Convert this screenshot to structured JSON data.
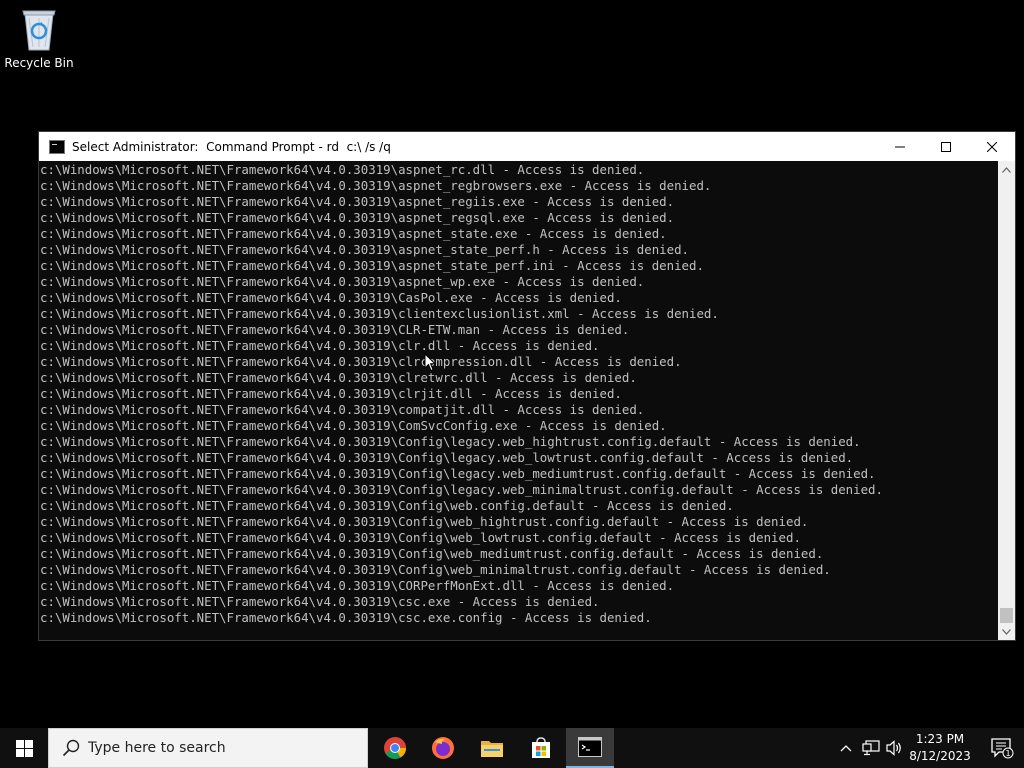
{
  "desktop": {
    "icons": [
      {
        "label": "Recycle Bin",
        "icon": "recycle-bin-icon"
      }
    ]
  },
  "window": {
    "title": "Select Administrator:  Command Prompt - rd  c:\\ /s /q",
    "controls": {
      "minimize": "minimize-icon",
      "maximize": "maximize-icon",
      "close": "close-icon"
    }
  },
  "console": {
    "lines": [
      "c:\\Windows\\Microsoft.NET\\Framework64\\v4.0.30319\\aspnet_rc.dll - Access is denied.",
      "c:\\Windows\\Microsoft.NET\\Framework64\\v4.0.30319\\aspnet_regbrowsers.exe - Access is denied.",
      "c:\\Windows\\Microsoft.NET\\Framework64\\v4.0.30319\\aspnet_regiis.exe - Access is denied.",
      "c:\\Windows\\Microsoft.NET\\Framework64\\v4.0.30319\\aspnet_regsql.exe - Access is denied.",
      "c:\\Windows\\Microsoft.NET\\Framework64\\v4.0.30319\\aspnet_state.exe - Access is denied.",
      "c:\\Windows\\Microsoft.NET\\Framework64\\v4.0.30319\\aspnet_state_perf.h - Access is denied.",
      "c:\\Windows\\Microsoft.NET\\Framework64\\v4.0.30319\\aspnet_state_perf.ini - Access is denied.",
      "c:\\Windows\\Microsoft.NET\\Framework64\\v4.0.30319\\aspnet_wp.exe - Access is denied.",
      "c:\\Windows\\Microsoft.NET\\Framework64\\v4.0.30319\\CasPol.exe - Access is denied.",
      "c:\\Windows\\Microsoft.NET\\Framework64\\v4.0.30319\\clientexclusionlist.xml - Access is denied.",
      "c:\\Windows\\Microsoft.NET\\Framework64\\v4.0.30319\\CLR-ETW.man - Access is denied.",
      "c:\\Windows\\Microsoft.NET\\Framework64\\v4.0.30319\\clr.dll - Access is denied.",
      "c:\\Windows\\Microsoft.NET\\Framework64\\v4.0.30319\\clrcompression.dll - Access is denied.",
      "c:\\Windows\\Microsoft.NET\\Framework64\\v4.0.30319\\clretwrc.dll - Access is denied.",
      "c:\\Windows\\Microsoft.NET\\Framework64\\v4.0.30319\\clrjit.dll - Access is denied.",
      "c:\\Windows\\Microsoft.NET\\Framework64\\v4.0.30319\\compatjit.dll - Access is denied.",
      "c:\\Windows\\Microsoft.NET\\Framework64\\v4.0.30319\\ComSvcConfig.exe - Access is denied.",
      "c:\\Windows\\Microsoft.NET\\Framework64\\v4.0.30319\\Config\\legacy.web_hightrust.config.default - Access is denied.",
      "c:\\Windows\\Microsoft.NET\\Framework64\\v4.0.30319\\Config\\legacy.web_lowtrust.config.default - Access is denied.",
      "c:\\Windows\\Microsoft.NET\\Framework64\\v4.0.30319\\Config\\legacy.web_mediumtrust.config.default - Access is denied.",
      "c:\\Windows\\Microsoft.NET\\Framework64\\v4.0.30319\\Config\\legacy.web_minimaltrust.config.default - Access is denied.",
      "c:\\Windows\\Microsoft.NET\\Framework64\\v4.0.30319\\Config\\web.config.default - Access is denied.",
      "c:\\Windows\\Microsoft.NET\\Framework64\\v4.0.30319\\Config\\web_hightrust.config.default - Access is denied.",
      "c:\\Windows\\Microsoft.NET\\Framework64\\v4.0.30319\\Config\\web_lowtrust.config.default - Access is denied.",
      "c:\\Windows\\Microsoft.NET\\Framework64\\v4.0.30319\\Config\\web_mediumtrust.config.default - Access is denied.",
      "c:\\Windows\\Microsoft.NET\\Framework64\\v4.0.30319\\Config\\web_minimaltrust.config.default - Access is denied.",
      "c:\\Windows\\Microsoft.NET\\Framework64\\v4.0.30319\\CORPerfMonExt.dll - Access is denied.",
      "c:\\Windows\\Microsoft.NET\\Framework64\\v4.0.30319\\csc.exe - Access is denied.",
      "c:\\Windows\\Microsoft.NET\\Framework64\\v4.0.30319\\csc.exe.config - Access is denied."
    ]
  },
  "taskbar": {
    "start_icon": "windows-logo-icon",
    "search_placeholder": "Type here to search",
    "apps": [
      {
        "name": "Google Chrome",
        "icon": "chrome-icon",
        "active": false
      },
      {
        "name": "Firefox",
        "icon": "firefox-icon",
        "active": false
      },
      {
        "name": "File Explorer",
        "icon": "file-explorer-icon",
        "active": false
      },
      {
        "name": "Microsoft Store",
        "icon": "store-icon",
        "active": false
      },
      {
        "name": "Command Prompt",
        "icon": "command-prompt-icon",
        "active": true
      }
    ],
    "tray": {
      "icons": [
        "chevron-up-icon",
        "network-icon",
        "volume-icon"
      ],
      "time": "1:23 PM",
      "date": "8/12/2023",
      "notification_count": "1"
    }
  },
  "colors": {
    "console_bg": "#0c0c0c",
    "console_text": "#c0c0c0",
    "taskbar_bg": "#101010",
    "accent": "#76b9ed"
  }
}
